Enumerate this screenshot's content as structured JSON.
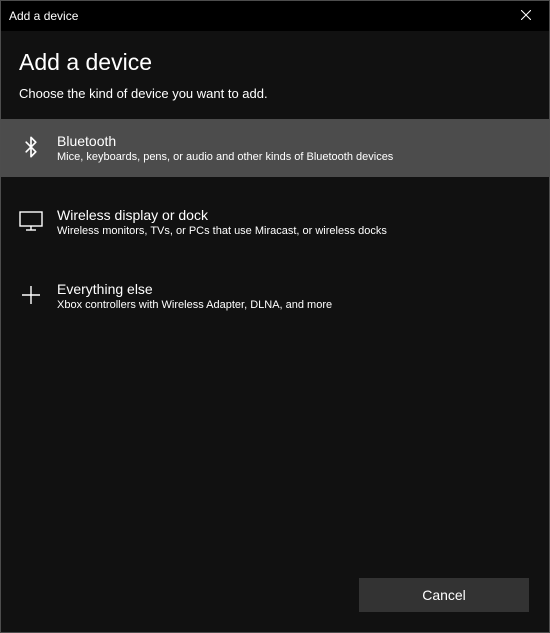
{
  "window": {
    "title": "Add a device"
  },
  "heading": "Add a device",
  "subheading": "Choose the kind of device you want to add.",
  "options": [
    {
      "title": "Bluetooth",
      "desc": "Mice, keyboards, pens, or audio and other kinds of Bluetooth devices",
      "selected": true
    },
    {
      "title": "Wireless display or dock",
      "desc": "Wireless monitors, TVs, or PCs that use Miracast, or wireless docks",
      "selected": false
    },
    {
      "title": "Everything else",
      "desc": "Xbox controllers with Wireless Adapter, DLNA, and more",
      "selected": false
    }
  ],
  "footer": {
    "cancel_label": "Cancel"
  }
}
